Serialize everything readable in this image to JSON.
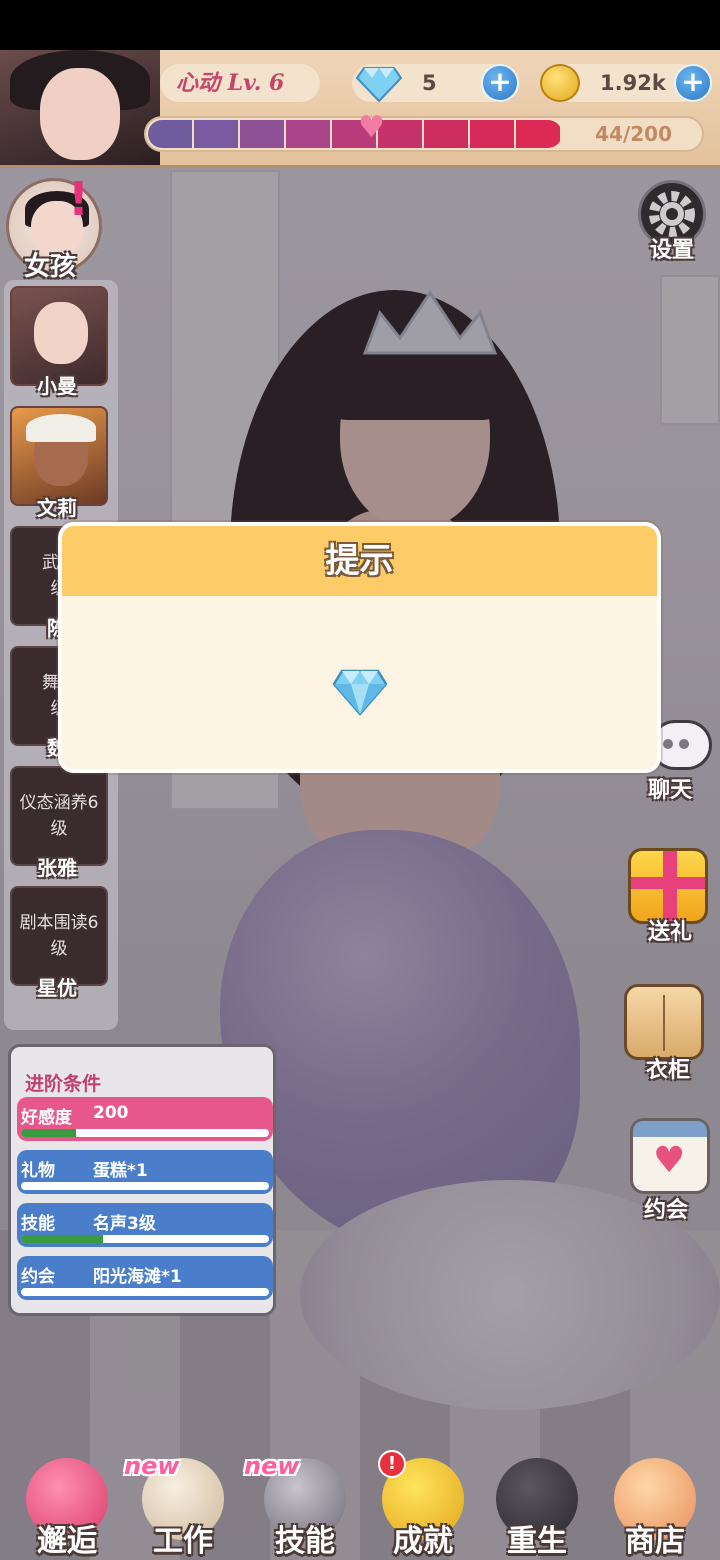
{
  "hud": {
    "level_label": "心动 Lv. 6",
    "gems": "5",
    "coins": "1.92k",
    "plus_symbol": "+",
    "affection_progress": "44/200",
    "affection_fraction": 0.22
  },
  "left": {
    "girl_tab_label": "女孩",
    "girls": [
      {
        "name": "小曼"
      },
      {
        "name": "文莉"
      },
      {
        "name": "陈",
        "requirement": "武术",
        "requirement_line2": "级"
      },
      {
        "name": "魏",
        "requirement": "舞台",
        "requirement_line2": "级"
      },
      {
        "name": "张雅",
        "requirement": "仪态涵养6",
        "requirement_line2": "级"
      },
      {
        "name": "星优",
        "requirement": "剧本围读6",
        "requirement_line2": "级"
      }
    ]
  },
  "requirements": {
    "title": "进阶条件",
    "rows": [
      {
        "key": "好感度",
        "value": "200",
        "progress": 0.22,
        "color": "#e8578a"
      },
      {
        "key": "礼物",
        "value": "蛋糕*1",
        "progress": 0.0,
        "color": "#4a7ecb"
      },
      {
        "key": "技能",
        "value": "名声3级",
        "progress": 0.33,
        "color": "#4a7ecb"
      },
      {
        "key": "约会",
        "value": "阳光海滩*1",
        "progress": 0.0,
        "color": "#4a7ecb"
      }
    ]
  },
  "right": {
    "settings_label": "设置",
    "chat_label": "聊天",
    "gift_label": "送礼",
    "wardrobe_label": "衣柜",
    "date_label": "约会"
  },
  "nav": {
    "encounter": "邂逅",
    "work": "工作",
    "skill": "技能",
    "achievement": "成就",
    "rebirth": "重生",
    "shop": "商店",
    "new_tag": "new",
    "alert_symbol": "!"
  },
  "modal": {
    "title": "提示",
    "icon": "diamond-gem-icon"
  },
  "colors": {
    "modal_header": "#fdcc69",
    "modal_body": "#fdf4e4",
    "gem_blue": "#7fd0f2",
    "plus_blue": "#3a8fdc"
  }
}
